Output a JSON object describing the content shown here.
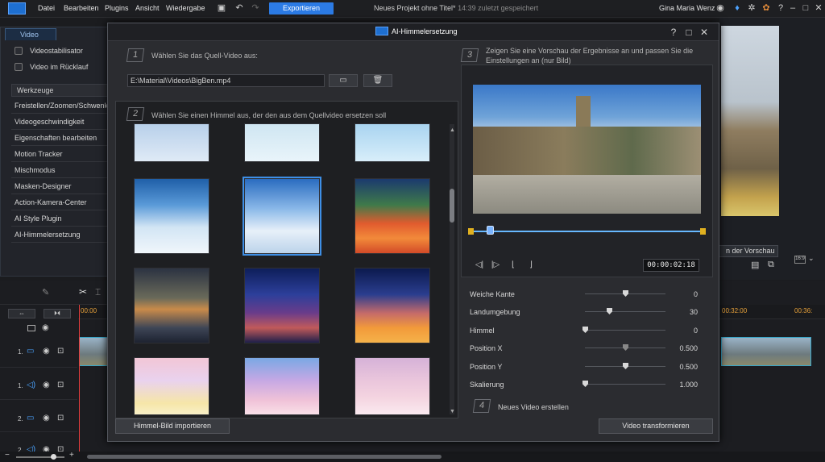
{
  "menu": [
    "Datei",
    "Bearbeiten",
    "Plugins",
    "Ansicht",
    "Wiedergabe"
  ],
  "export_label": "Exportieren",
  "project_title": "Neues Projekt ohne Titel*",
  "save_status": "14:39 zuletzt gespeichert",
  "user_name": "Gina Maria Wenz",
  "left_panel": {
    "tab": "Video",
    "checkboxes": [
      "Videostabilisator",
      "Video im Rücklauf"
    ],
    "section": "Werkzeuge",
    "tools": [
      "Freistellen/Zoomen/Schwenken",
      "Videogeschwindigkeit",
      "Eigenschaften bearbeiten",
      "Motion Tracker",
      "Mischmodus",
      "Masken-Designer",
      "Action-Kamera-Center",
      "AI Style Plugin",
      "AI-Himmelersetzung"
    ]
  },
  "preview_button": "n der Vorschau",
  "aspect": "16:9",
  "timeline": {
    "time_start": "00:00",
    "time_32": "00:32:00",
    "time_36": "00:36:",
    "tracks": [
      "1.",
      "1.",
      "2.",
      "2."
    ]
  },
  "dialog": {
    "title": "AI-Himmelersetzung",
    "step1_num": "1",
    "step1_label": "Wählen Sie das Quell-Video aus:",
    "path": "E:\\Material\\Videos\\BigBen.mp4",
    "step2_num": "2",
    "step2_label": "Wählen Sie einen Himmel aus, der den aus dem Quellvideo ersetzen soll",
    "step3_num": "3",
    "step3_label_line1": "Zeigen Sie eine Vorschau der Ergebnisse an und passen Sie die",
    "step3_label_line2": "Einstellungen an (nur Bild)",
    "import_button": "Himmel-Bild importieren",
    "timecode": "00:00:02:18",
    "params": [
      {
        "label": "Weiche Kante",
        "value": "0",
        "level": 0.5
      },
      {
        "label": "Landumgebung",
        "value": "30",
        "level": 0.3
      },
      {
        "label": "Himmel",
        "value": "0",
        "level": 0.0
      },
      {
        "label": "Position X",
        "value": "0.500",
        "level": 0.5
      },
      {
        "label": "Position Y",
        "value": "0.500",
        "level": 0.5
      },
      {
        "label": "Skalierung",
        "value": "1.000",
        "level": 0.0
      }
    ],
    "step4_num": "4",
    "step4_label": "Neues Video erstellen",
    "transform_button": "Video transformieren"
  },
  "colors": {
    "accent": "#2c7be5",
    "selection": "#3e8fe6",
    "playhead": "#e23d3d",
    "timecode": "#e8a23a"
  }
}
